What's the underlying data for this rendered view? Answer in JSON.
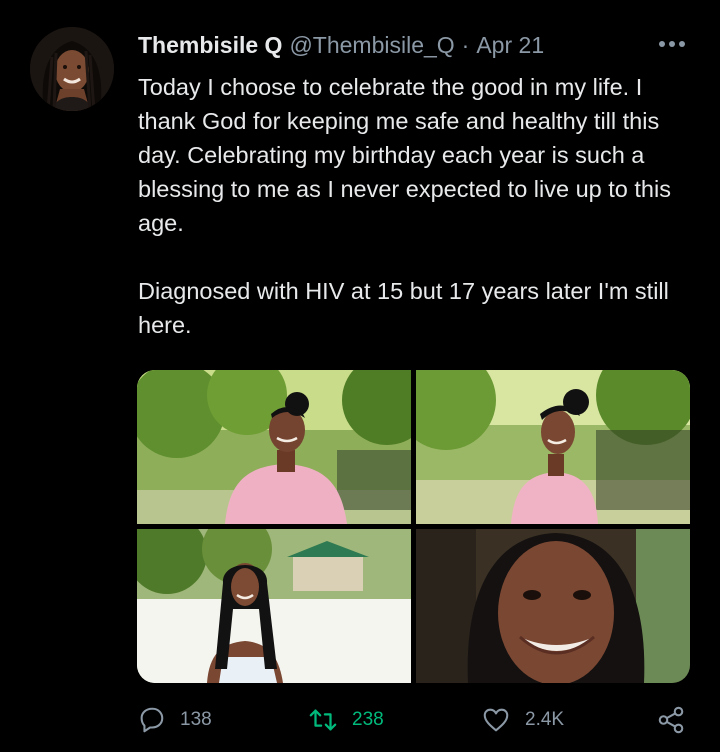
{
  "user": {
    "display_name": "Thembisile Q",
    "handle": "@Thembisile_Q",
    "separator": "·",
    "date": "Apr 21"
  },
  "tweet": {
    "paragraph1": "Today I choose to celebrate the good in my life. I thank God for keeping me safe and healthy till this day. Celebrating my birthday each year is such a blessing to me as I never expected to live up to this age.",
    "paragraph2": "Diagnosed with HIV at 15 but 17 years later I'm still here."
  },
  "media": {
    "photo_count": 4
  },
  "actions": {
    "replies": "138",
    "retweets": "238",
    "likes": "2.4K"
  },
  "icons": {
    "more": "more-dots-icon",
    "reply": "reply-bubble-icon",
    "retweet": "retweet-icon",
    "like": "heart-icon",
    "share": "share-icon"
  },
  "colors": {
    "background": "#000000",
    "text_primary": "#e7e9ea",
    "text_secondary": "#8b98a5",
    "retweet_active": "#00ba7c"
  }
}
